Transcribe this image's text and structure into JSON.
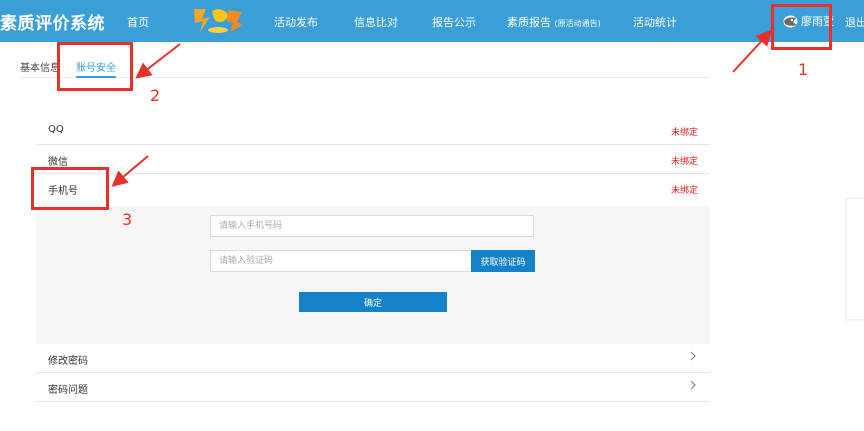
{
  "header": {
    "app_title": "素质评价系统",
    "nav": [
      {
        "label": "首页"
      },
      {
        "label": "活动发布"
      },
      {
        "label": "信息比对"
      },
      {
        "label": "报告公示"
      },
      {
        "label": "素质报告",
        "sub": "(原活动通告)"
      },
      {
        "label": "活动统计"
      }
    ],
    "user_name": "廖雨萱",
    "logout_label": "退出"
  },
  "tabs": [
    {
      "label": "基本信息"
    },
    {
      "label": "账号安全",
      "active": true
    }
  ],
  "bindings": [
    {
      "label": "QQ",
      "status": "未绑定"
    },
    {
      "label": "微信",
      "status": "未绑定"
    },
    {
      "label": "手机号",
      "status": "未绑定"
    }
  ],
  "phone_form": {
    "phone_placeholder": "请输入手机号码",
    "code_placeholder": "请输入验证码",
    "get_code_label": "获取验证码",
    "confirm_label": "确定"
  },
  "settings": [
    {
      "label": "修改密码"
    },
    {
      "label": "密码问题"
    }
  ],
  "annotations": [
    "1",
    "2",
    "3"
  ],
  "colors": {
    "header_bg": "#3a9fd9",
    "accent": "#3a9fd9",
    "button": "#1581c8",
    "status_red": "#e02020",
    "annotation_red": "#e8312a"
  }
}
